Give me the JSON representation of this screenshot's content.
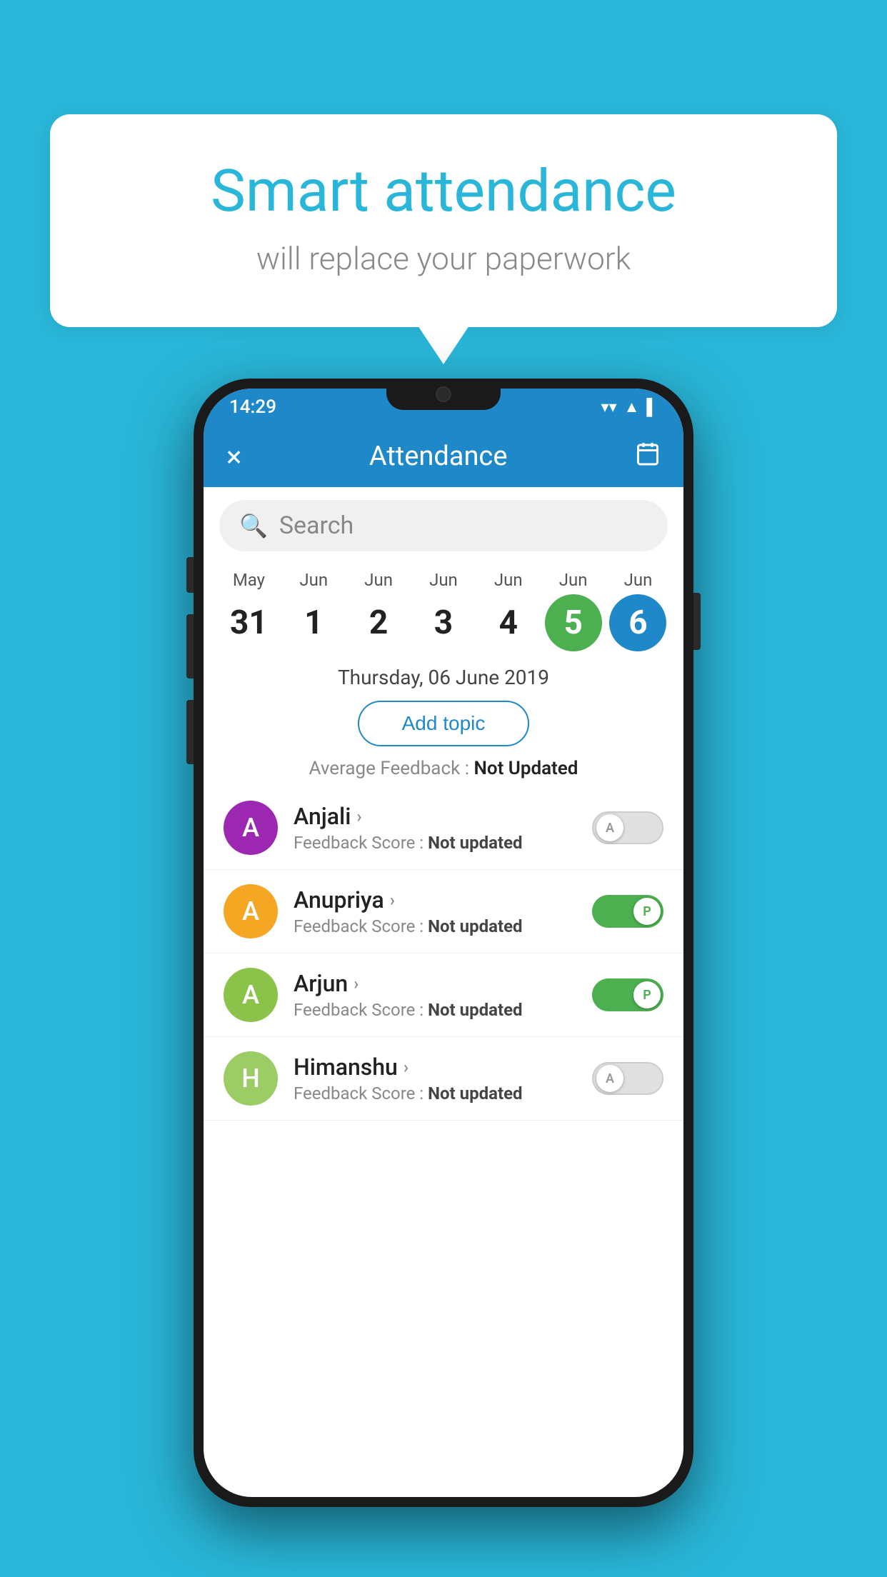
{
  "background_color": "#29b6d8",
  "bubble": {
    "title": "Smart attendance",
    "subtitle": "will replace your paperwork"
  },
  "status_bar": {
    "time": "14:29",
    "icons": [
      "wifi",
      "signal",
      "battery"
    ]
  },
  "app_bar": {
    "title": "Attendance",
    "close_label": "×",
    "calendar_icon": "📅"
  },
  "search": {
    "placeholder": "Search"
  },
  "dates": [
    {
      "month": "May",
      "day": "31",
      "state": "normal"
    },
    {
      "month": "Jun",
      "day": "1",
      "state": "normal"
    },
    {
      "month": "Jun",
      "day": "2",
      "state": "normal"
    },
    {
      "month": "Jun",
      "day": "3",
      "state": "normal"
    },
    {
      "month": "Jun",
      "day": "4",
      "state": "normal"
    },
    {
      "month": "Jun",
      "day": "5",
      "state": "today"
    },
    {
      "month": "Jun",
      "day": "6",
      "state": "selected"
    }
  ],
  "selected_date_label": "Thursday, 06 June 2019",
  "add_topic_label": "Add topic",
  "avg_feedback_label": "Average Feedback :",
  "avg_feedback_value": "Not Updated",
  "students": [
    {
      "name": "Anjali",
      "initial": "A",
      "avatar_color": "#9c27b0",
      "feedback_label": "Feedback Score :",
      "feedback_value": "Not updated",
      "attendance": "absent",
      "toggle_label": "A"
    },
    {
      "name": "Anupriya",
      "initial": "A",
      "avatar_color": "#f5a623",
      "feedback_label": "Feedback Score :",
      "feedback_value": "Not updated",
      "attendance": "present",
      "toggle_label": "P"
    },
    {
      "name": "Arjun",
      "initial": "A",
      "avatar_color": "#8bc34a",
      "feedback_label": "Feedback Score :",
      "feedback_value": "Not updated",
      "attendance": "present",
      "toggle_label": "P"
    },
    {
      "name": "Himanshu",
      "initial": "H",
      "avatar_color": "#9ccc65",
      "feedback_label": "Feedback Score :",
      "feedback_value": "Not updated",
      "attendance": "absent",
      "toggle_label": "A"
    }
  ]
}
